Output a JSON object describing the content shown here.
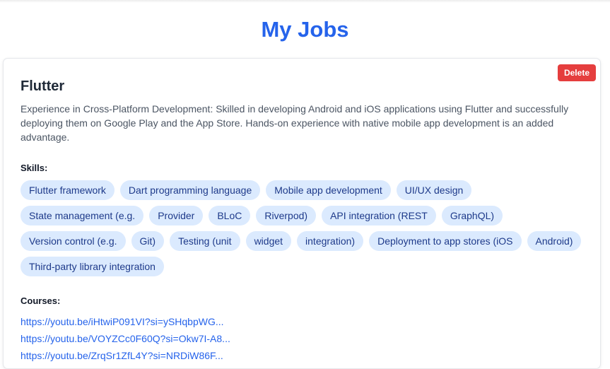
{
  "page": {
    "title": "My Jobs"
  },
  "job": {
    "title": "Flutter",
    "delete_label": "Delete",
    "description": "Experience in Cross-Platform Development: Skilled in developing Android and iOS applications using Flutter and successfully deploying them on Google Play and the App Store. Hands-on experience with native mobile app development is an added advantage.",
    "skills_label": "Skills:",
    "skills": [
      "Flutter framework",
      "Dart programming language",
      "Mobile app development",
      "UI/UX design",
      "State management (e.g.",
      "Provider",
      "BLoC",
      "Riverpod)",
      "API integration (REST",
      "GraphQL)",
      "Version control (e.g.",
      "Git)",
      "Testing (unit",
      "widget",
      "integration)",
      "Deployment to app stores (iOS",
      "Android)",
      "Third-party library integration"
    ],
    "courses_label": "Courses:",
    "courses": [
      "https://youtu.be/iHtwiP091VI?si=ySHqbpWG...",
      "https://youtu.be/VOYZCc0F60Q?si=Okw7I-A8...",
      "https://youtu.be/ZrqSr1ZfL4Y?si=NRDiW86F..."
    ]
  },
  "colors": {
    "accent": "#2563eb",
    "delete": "#e53e3e",
    "chip_bg": "#dbeafe",
    "chip_text": "#1e3a8a"
  }
}
